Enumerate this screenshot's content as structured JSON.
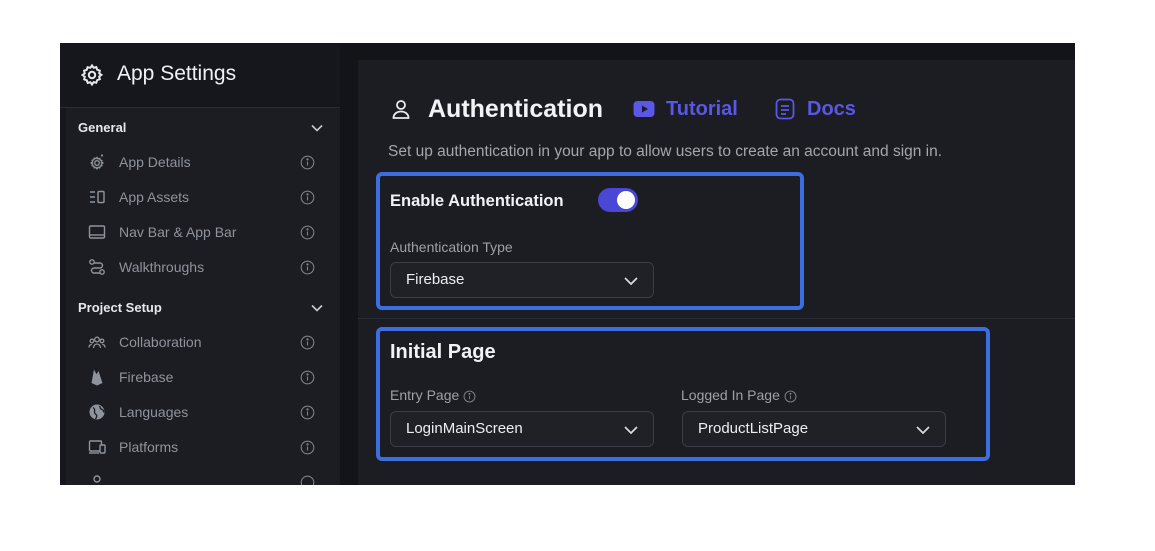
{
  "sidebar": {
    "title": "App Settings",
    "sections": [
      {
        "label": "General",
        "items": [
          {
            "label": "App Details",
            "icon": "gear-sparkle-icon"
          },
          {
            "label": "App Assets",
            "icon": "assets-icon"
          },
          {
            "label": "Nav Bar & App Bar",
            "icon": "navbar-icon"
          },
          {
            "label": "Walkthroughs",
            "icon": "route-icon"
          }
        ]
      },
      {
        "label": "Project Setup",
        "items": [
          {
            "label": "Collaboration",
            "icon": "users-icon"
          },
          {
            "label": "Firebase",
            "icon": "firebase-icon"
          },
          {
            "label": "Languages",
            "icon": "globe-icon"
          },
          {
            "label": "Platforms",
            "icon": "devices-icon"
          }
        ]
      }
    ]
  },
  "main": {
    "title": "Authentication",
    "tutorial_label": "Tutorial",
    "docs_label": "Docs",
    "subtitle": "Set up authentication in your app to allow users to create an account and sign in.",
    "enable_label": "Enable Authentication",
    "enable_on": true,
    "auth_type_label": "Authentication Type",
    "auth_type_value": "Firebase",
    "initial_page_title": "Initial Page",
    "entry_page_label": "Entry Page",
    "entry_page_value": "LoginMainScreen",
    "logged_in_page_label": "Logged In Page",
    "logged_in_page_value": "ProductListPage"
  },
  "colors": {
    "accent": "#5a57e6",
    "toggle": "#4b47d6",
    "highlight_border": "#3d6ee0"
  }
}
